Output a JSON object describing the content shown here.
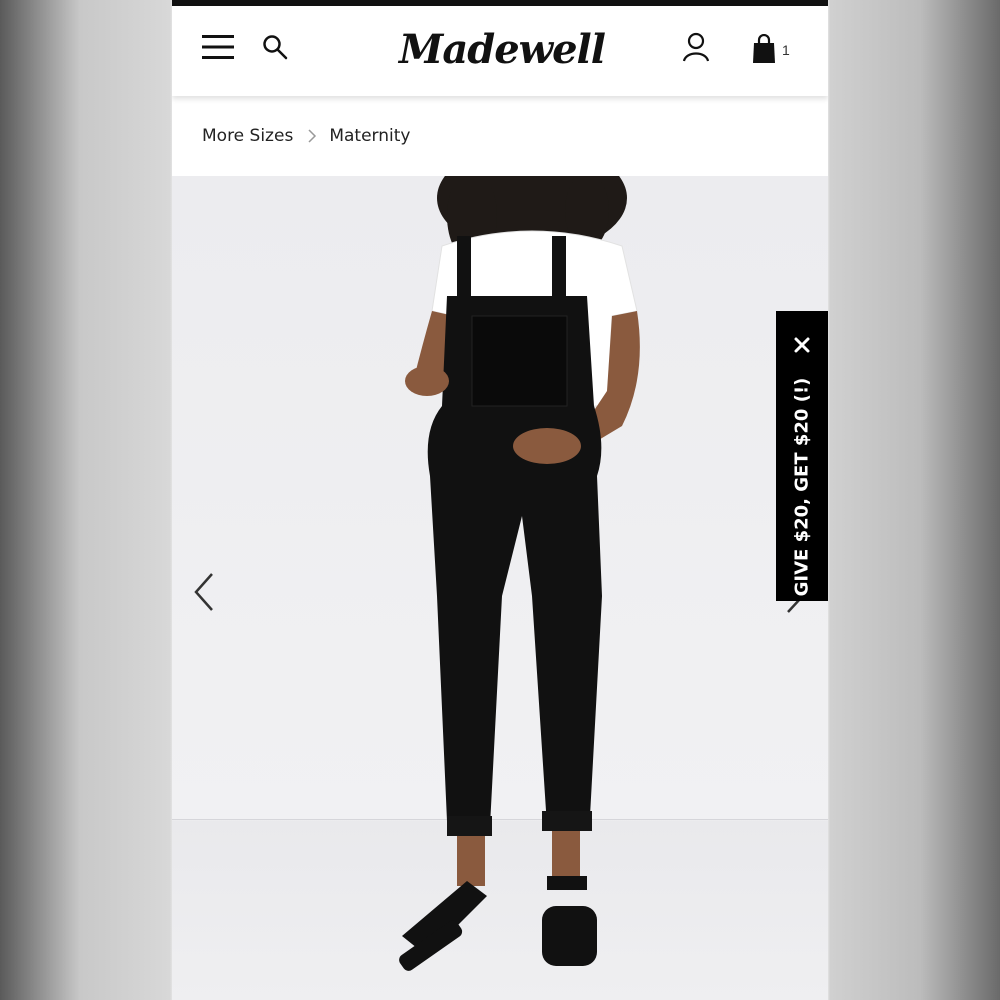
{
  "header": {
    "brand": "Madewell",
    "bag_count": "1"
  },
  "breadcrumb": {
    "items": [
      "More Sizes",
      "Maternity"
    ]
  },
  "promo": {
    "text": "GIVE $20, GET $20 (!)"
  },
  "icons": {
    "menu": "hamburger-menu-icon",
    "search": "search-icon",
    "account": "account-icon",
    "bag": "shopping-bag-icon",
    "separator": "chevron-right-icon",
    "prev": "chevron-left-icon",
    "next": "chevron-right-icon",
    "close": "close-icon"
  },
  "colors": {
    "header_bg": "#ffffff",
    "promo_bg": "#000000",
    "promo_text": "#ffffff"
  }
}
